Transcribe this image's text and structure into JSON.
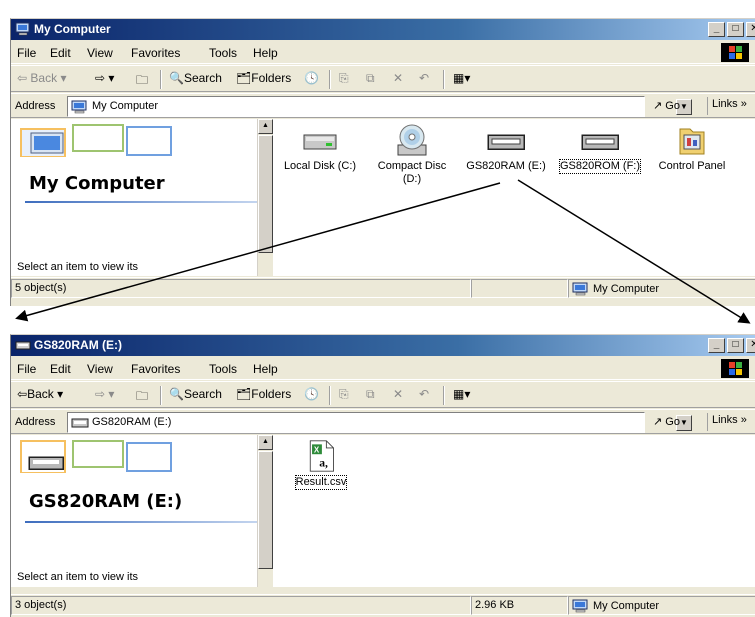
{
  "window1": {
    "title": "My Computer",
    "menu": [
      "File",
      "Edit",
      "View",
      "Favorites",
      "Tools",
      "Help"
    ],
    "toolbar": {
      "back": "Back",
      "search": "Search",
      "folders": "Folders"
    },
    "address": {
      "label": "Address",
      "value": "My Computer",
      "go": "Go",
      "links": "Links"
    },
    "left_panel": {
      "title": "My Computer",
      "hint": "Select an item to view its"
    },
    "drives": [
      {
        "label": "Local Disk (C:)",
        "icon": "hard-drive-icon"
      },
      {
        "label": "Compact Disc (D:)",
        "icon": "cd-drive-icon"
      },
      {
        "label": "GS820RAM (E:)",
        "icon": "removable-drive-icon"
      },
      {
        "label": "GS820ROM (F:)",
        "icon": "removable-drive-icon"
      },
      {
        "label": "Control Panel",
        "icon": "control-panel-icon"
      }
    ],
    "status": {
      "objects": "5 object(s)",
      "size": "",
      "zone": "My Computer"
    }
  },
  "window2": {
    "title": "GS820RAM (E:)",
    "menu": [
      "File",
      "Edit",
      "View",
      "Favorites",
      "Tools",
      "Help"
    ],
    "toolbar": {
      "back": "Back",
      "search": "Search",
      "folders": "Folders"
    },
    "address": {
      "label": "Address",
      "value": "GS820RAM (E:)",
      "go": "Go",
      "links": "Links"
    },
    "left_panel": {
      "title": "GS820RAM (E:)",
      "hint": "Select an item to view its"
    },
    "files": [
      {
        "label": "Result.csv",
        "icon": "csv-file-icon",
        "glyph": "a,"
      }
    ],
    "status": {
      "objects": "3 object(s)",
      "size": "2.96 KB",
      "zone": "My Computer"
    }
  },
  "colors": {
    "titlebar_start": "#0a246a",
    "titlebar_end": "#a6caf0",
    "chrome": "#ece9d8"
  }
}
